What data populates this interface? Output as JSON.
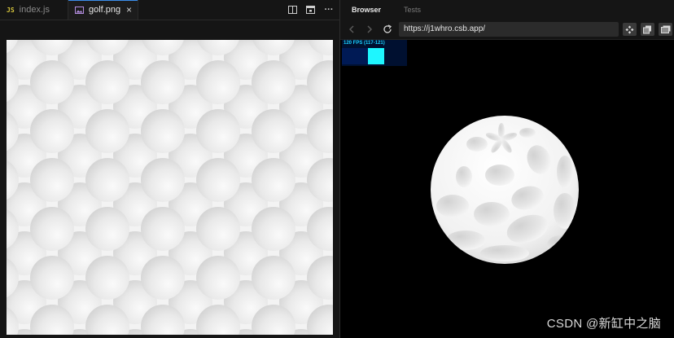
{
  "editor": {
    "tabs": [
      {
        "badge": "JS",
        "label": "index.js"
      },
      {
        "label": "golf.png",
        "close": "×"
      }
    ],
    "toolbar": {
      "icons": [
        "split-editor-icon",
        "open-preview-icon",
        "more-icon"
      ],
      "more_label": "···"
    }
  },
  "browser": {
    "tabs": [
      "Browser",
      "Tests"
    ],
    "url": "https://j1whro.csb.app/",
    "stats": {
      "fps_label": "120 FPS (117-121)"
    }
  },
  "watermark": "CSDN @新缸中之脑",
  "colors": {
    "accent": "#3b8eea",
    "fps_text": "#19d0ff",
    "fps_bar": "#1ef6ff",
    "fps_bg": "#001030"
  }
}
